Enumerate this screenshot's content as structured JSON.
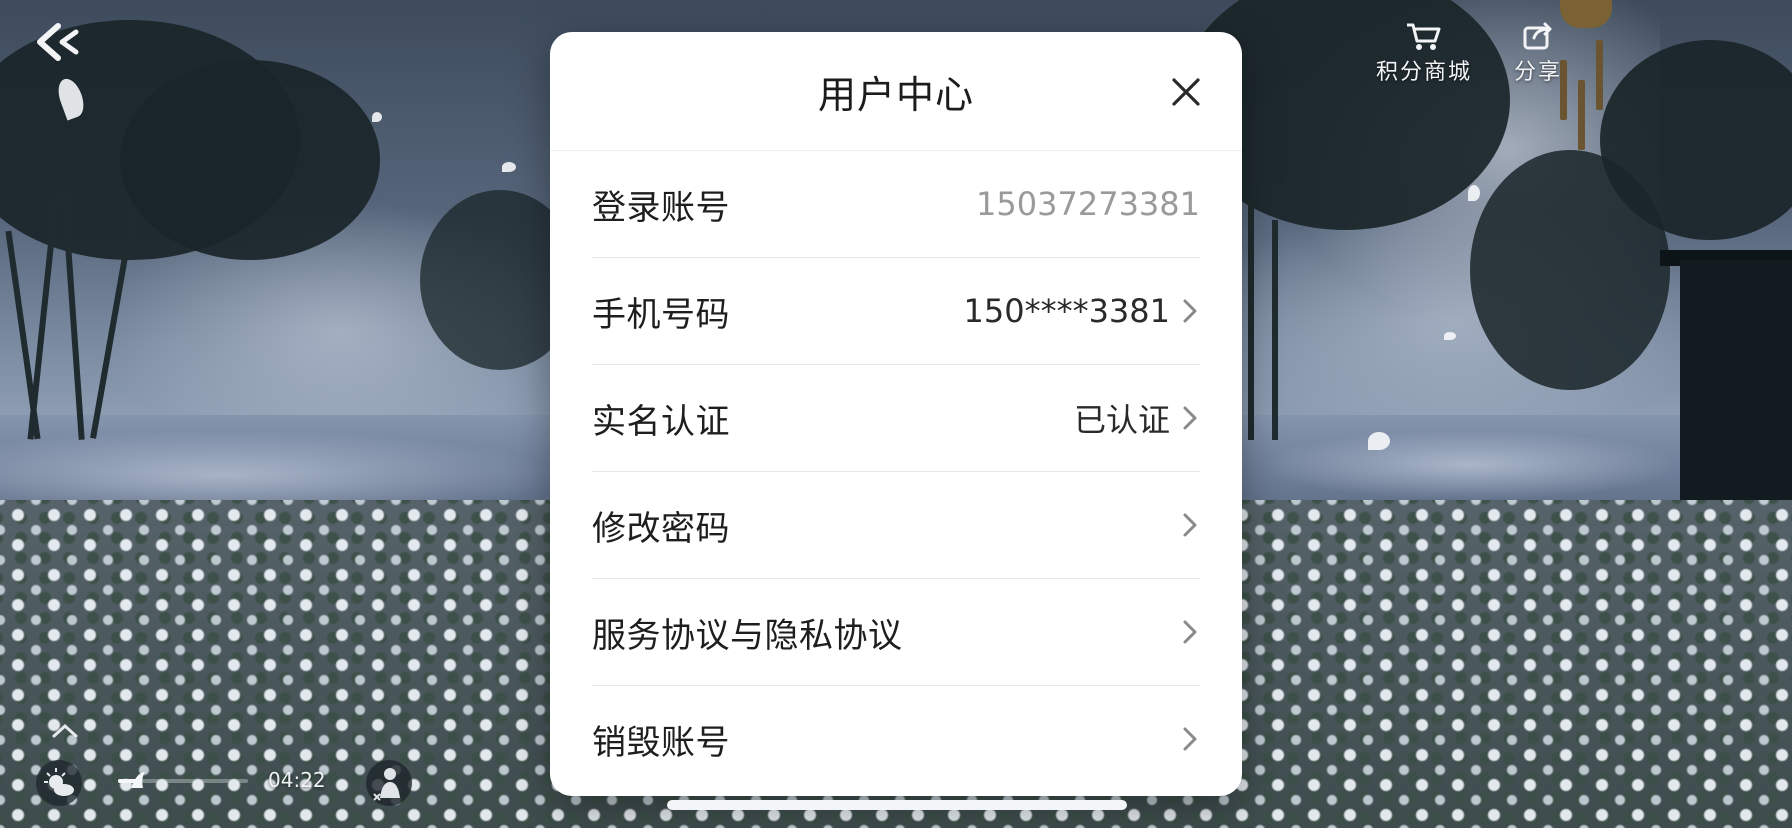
{
  "hud": {
    "back_icon": "back-arrow-icon",
    "points_mall": {
      "label": "积分商城",
      "icon": "cart-icon"
    },
    "share": {
      "label": "分享",
      "icon": "share-icon"
    },
    "time": "04:22",
    "progress": 0.15
  },
  "dialog": {
    "title": "用户中心",
    "close_icon": "close-icon",
    "rows": [
      {
        "label": "登录账号",
        "value": "15037273381",
        "chevron": false
      },
      {
        "label": "手机号码",
        "value": "150****3381",
        "chevron": true
      },
      {
        "label": "实名认证",
        "value": "已认证",
        "chevron": true
      },
      {
        "label": "修改密码",
        "value": "",
        "chevron": true
      },
      {
        "label": "服务协议与隐私协议",
        "value": "",
        "chevron": true
      },
      {
        "label": "销毁账号",
        "value": "",
        "chevron": true
      }
    ]
  },
  "colors": {
    "dialog_bg": "#ffffff",
    "text_primary": "#1e1e1e",
    "text_muted": "#9a9a9a",
    "divider": "#e6e6e6"
  }
}
